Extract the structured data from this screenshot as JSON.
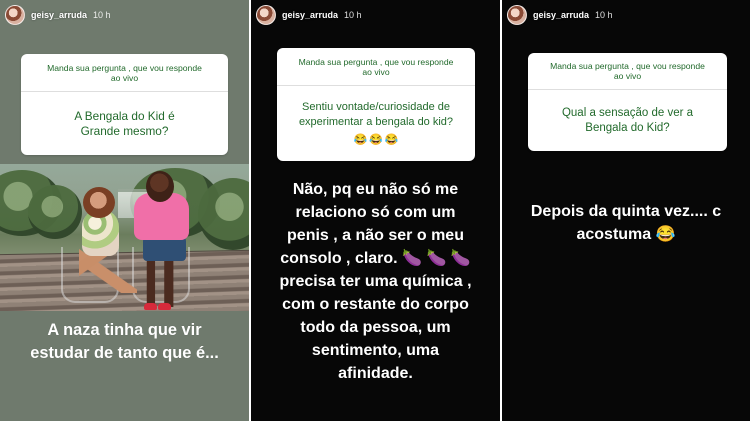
{
  "stories": [
    {
      "header": {
        "username": "geisy_arruda",
        "time": "10 h"
      },
      "question": {
        "prompt_lines": [
          "Manda sua pergunta , que vou responde",
          "ao vivo"
        ],
        "text_lines": [
          "A Bengala do Kid é",
          "Grande mesmo?"
        ]
      },
      "caption_lines": [
        "A naza tinha que vir",
        "estudar de tanto que é..."
      ]
    },
    {
      "header": {
        "username": "geisy_arruda",
        "time": "10 h"
      },
      "question": {
        "prompt_lines": [
          "Manda sua pergunta , que vou responde",
          "ao vivo"
        ],
        "text_lines": [
          "Sentiu vontade/curiosidade de",
          "experimentar a bengala do kid?"
        ],
        "emojis": [
          "😂",
          "😂",
          "😂"
        ]
      },
      "answer_lines": [
        "Não, pq eu não só me",
        "relaciono só com um",
        "penis , a não ser o meu",
        "consolo , claro. 🍆 🍆 🍆",
        "precisa ter uma química ,",
        "com o restante do corpo",
        "todo da pessoa, um",
        "sentimento, uma",
        "afinidade."
      ]
    },
    {
      "header": {
        "username": "geisy_arruda",
        "time": "10 h"
      },
      "question": {
        "prompt_lines": [
          "Manda sua pergunta , que vou responde",
          "ao vivo"
        ],
        "text_lines": [
          "Qual a sensação de ver a",
          "Bengala do Kid?"
        ]
      },
      "answer_lines": [
        "Depois da quinta vez.... c",
        "acostuma 😂"
      ]
    }
  ],
  "colors": {
    "question_green": "#226a2c",
    "story_dark": "#070707",
    "story_green": "#6f7a6d",
    "shirt_pink": "#f06fa8"
  },
  "icons": {
    "avatar": "profile-avatar"
  }
}
